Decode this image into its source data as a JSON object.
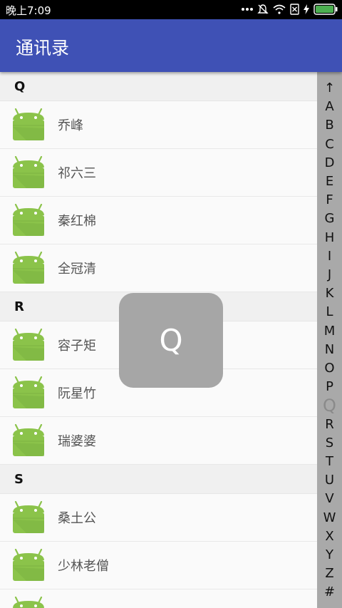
{
  "status_bar": {
    "time": "晚上7:09",
    "icons": [
      "more-dots-icon",
      "silent-icon",
      "wifi-icon",
      "sim-off-icon",
      "lightning-icon",
      "battery-icon"
    ]
  },
  "app_bar": {
    "title": "通讯录"
  },
  "colors": {
    "primary": "#3f51b5",
    "android_green": "#8bc34a",
    "index_bar": "#a9a9a9",
    "overlay": "#a6a6a6"
  },
  "sections": [
    {
      "letter": "Q",
      "contacts": [
        "乔峰",
        "祁六三",
        "秦红棉",
        "全冠清"
      ]
    },
    {
      "letter": "R",
      "contacts": [
        "容子矩",
        "阮星竹",
        "瑞婆婆"
      ]
    },
    {
      "letter": "S",
      "contacts": [
        "桑土公",
        "少林老僧",
        ""
      ]
    }
  ],
  "index_bar": {
    "letters": [
      "↑",
      "A",
      "B",
      "C",
      "D",
      "E",
      "F",
      "G",
      "H",
      "I",
      "J",
      "K",
      "L",
      "M",
      "N",
      "O",
      "P",
      "Q",
      "R",
      "S",
      "T",
      "U",
      "V",
      "W",
      "X",
      "Y",
      "Z",
      "#"
    ],
    "active": "Q"
  },
  "overlay": {
    "letter": "Q"
  }
}
